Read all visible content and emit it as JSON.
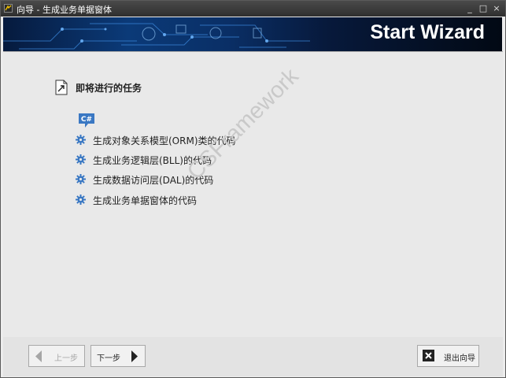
{
  "window": {
    "title": "向导 - 生成业务单据窗体"
  },
  "title_controls": {
    "minimize": "_",
    "maximize": "□",
    "close": "×"
  },
  "banner": {
    "title": "Start Wizard"
  },
  "tasks": {
    "heading": "即将进行的任务",
    "badge": "C#",
    "items": [
      {
        "label": "生成对象关系模型(ORM)类的代码"
      },
      {
        "label": "生成业务逻辑层(BLL)的代码"
      },
      {
        "label": "生成数据访问层(DAL)的代码"
      },
      {
        "label": "生成业务单据窗体的代码"
      }
    ]
  },
  "watermark": "CSFramework",
  "footer": {
    "prev_label": "上一步",
    "next_label": "下一步",
    "exit_label": "退出向导"
  },
  "colors": {
    "accent": "#3a78c3",
    "banner": "#07193b"
  }
}
